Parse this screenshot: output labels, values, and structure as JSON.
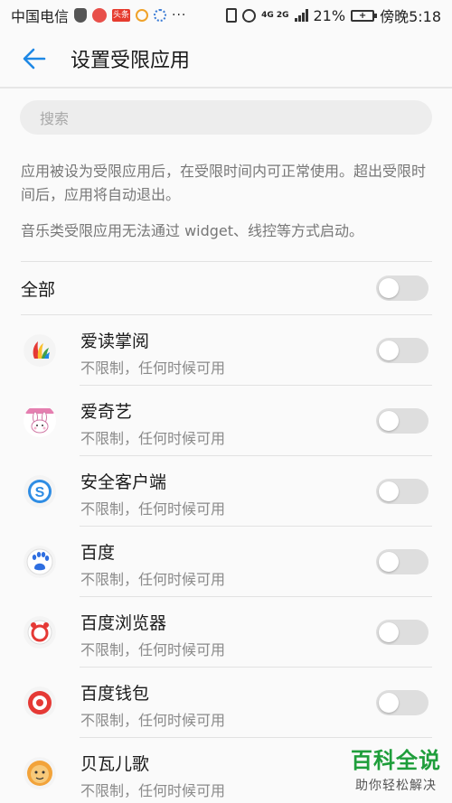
{
  "status_bar": {
    "carrier": "中国电信",
    "toutiao_badge": "头条",
    "dots": "···",
    "network": "4G 2G",
    "battery": "21%",
    "time": "傍晚5:18"
  },
  "header": {
    "title": "设置受限应用"
  },
  "search": {
    "placeholder": "搜索"
  },
  "description": {
    "line1": "应用被设为受限应用后，在受限时间内可正常使用。超出受限时间后，应用将自动退出。",
    "line2": "音乐类受限应用无法通过 widget、线控等方式启动。"
  },
  "all_row": {
    "label": "全部",
    "enabled": false
  },
  "apps": [
    {
      "name": "爱读掌阅",
      "status": "不限制，任何时候可用",
      "enabled": false,
      "icon": "ireader-icon"
    },
    {
      "name": "爱奇艺",
      "status": "不限制，任何时候可用",
      "enabled": false,
      "icon": "iqiyi-icon"
    },
    {
      "name": "安全客户端",
      "status": "不限制，任何时候可用",
      "enabled": false,
      "icon": "security-client-icon"
    },
    {
      "name": "百度",
      "status": "不限制，任何时候可用",
      "enabled": false,
      "icon": "baidu-icon"
    },
    {
      "name": "百度浏览器",
      "status": "不限制，任何时候可用",
      "enabled": false,
      "icon": "baidu-browser-icon"
    },
    {
      "name": "百度钱包",
      "status": "不限制，任何时候可用",
      "enabled": false,
      "icon": "baidu-wallet-icon"
    },
    {
      "name": "贝瓦儿歌",
      "status": "不限制，任何时候可用",
      "enabled": false,
      "icon": "beva-songs-icon"
    }
  ],
  "watermark": {
    "title": "百科全说",
    "subtitle": "助你轻松解决"
  },
  "colors": {
    "accent": "#1e88e5",
    "toggle_off": "#dedede",
    "watermark_green": "#1f9e3b"
  }
}
